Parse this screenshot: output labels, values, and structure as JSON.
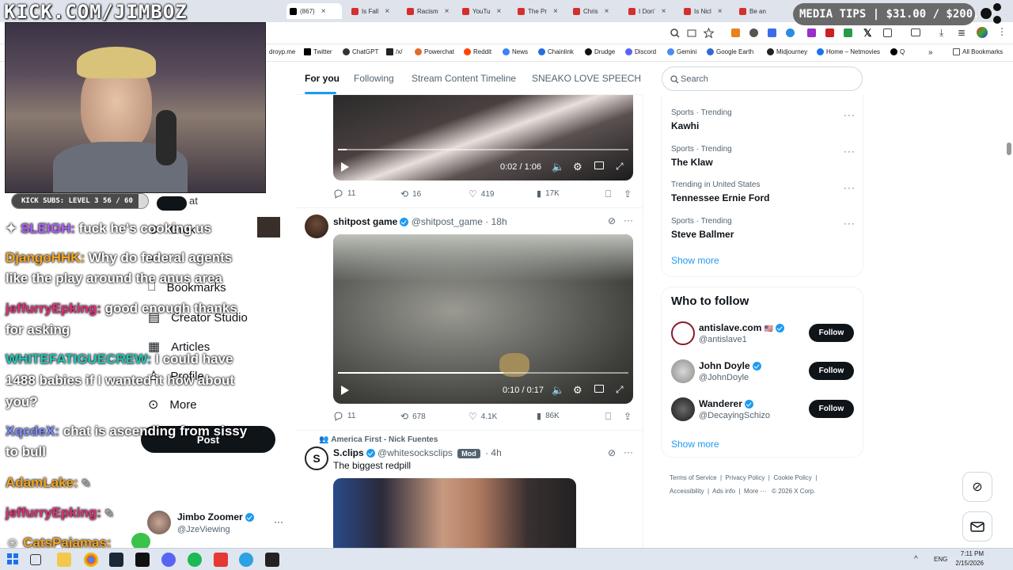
{
  "stream": {
    "url_banner": "KICK.COM/JIMBOZ",
    "media_tips": "MEDIA TIPS | $31.00 / $200.00",
    "subs_goal": "KICK SUBS: LEVEL 3 56 / 60",
    "chat": [
      {
        "user": "SLEIGH:",
        "color": "#b05cff",
        "msg": "fuck he's cooking us"
      },
      {
        "user": "DjangoHHK:",
        "color": "#f5a623",
        "msg": "Why do federal agents"
      },
      {
        "user": "",
        "color": "#ffffff",
        "msg": "like the play around the anus area"
      },
      {
        "user": "jeffurryEpking:",
        "color": "#e0307a",
        "msg": "good enough thanks"
      },
      {
        "user": "",
        "color": "#ffffff",
        "msg": "for asking"
      },
      {
        "user": "WHITEFATIGUECREW:",
        "color": "#21c6b8",
        "msg": "I could have"
      },
      {
        "user": "",
        "color": "#ffffff",
        "msg": "1488 babies if I wanted it how about"
      },
      {
        "user": "",
        "color": "#ffffff",
        "msg": "you?"
      },
      {
        "user": "XqcdeX:",
        "color": "#7a8cff",
        "msg": "chat is ascending from sissy"
      },
      {
        "user": "",
        "color": "#ffffff",
        "msg": "to bull"
      },
      {
        "user": "AdamLake:",
        "color": "#f5a623",
        "msg": ""
      },
      {
        "user": "jeffurryEpking:",
        "color": "#e0307a",
        "msg": ""
      },
      {
        "user": "CatsPajamas:",
        "color": "#f5a623",
        "msg": ""
      }
    ]
  },
  "browser": {
    "tabs": [
      {
        "label": "(867)"
      },
      {
        "label": "Is Fall"
      },
      {
        "label": "Racism"
      },
      {
        "label": "YouTu"
      },
      {
        "label": "The Pr"
      },
      {
        "label": "Chris"
      },
      {
        "label": "I Don'"
      },
      {
        "label": "Is Nicl"
      },
      {
        "label": "Be an"
      }
    ],
    "bookmarks": [
      "droyp.me",
      "Twitter",
      "ChatGPT",
      "/x/",
      "Powerchat",
      "Reddit",
      "News",
      "Chainlink",
      "Drudge",
      "Discord",
      "Gemini",
      "Google Earth",
      "Midjourney",
      "Home – Netmovies",
      "Q",
      "All Bookmarks"
    ]
  },
  "nav_menu": {
    "items": [
      "Grok",
      "Bookmarks",
      "Creator Studio",
      "Articles",
      "Profile",
      "More"
    ],
    "post_label": "Post",
    "partial_label": "at",
    "account": {
      "name": "Jimbo Zoomer",
      "handle": "@JzeViewing"
    }
  },
  "feed": {
    "tabs": [
      "For you",
      "Following",
      "Stream Content Timeline",
      "SNEAKO LOVE SPEECH"
    ],
    "post1": {
      "time": "0:02 / 1:06",
      "replies": "11",
      "reposts": "16",
      "likes": "419",
      "views": "17K"
    },
    "post2": {
      "name": "shitpost game",
      "handle": "@shitpost_game",
      "ago": "· 18h",
      "time": "0:10 / 0:17",
      "replies": "11",
      "reposts": "678",
      "likes": "4.1K",
      "views": "86K"
    },
    "post3": {
      "community": "America First - Nick Fuentes",
      "name": "S.clips",
      "handle": "@whitesocksclips",
      "badge": "Mod",
      "ago": "· 4h",
      "text": "The biggest redpill"
    }
  },
  "sidebar": {
    "search_placeholder": "Search",
    "trends": [
      {
        "meta": "Sports · Trending",
        "name": "Kawhi"
      },
      {
        "meta": "Sports · Trending",
        "name": "The Klaw"
      },
      {
        "meta": "Trending in United States",
        "name": "Tennessee Ernie Ford"
      },
      {
        "meta": "Sports · Trending",
        "name": "Steve Ballmer"
      }
    ],
    "show_more": "Show more",
    "who_to_follow": "Who to follow",
    "follow": [
      {
        "name": "antislave.com",
        "handle": "@antislave1",
        "button": "Follow"
      },
      {
        "name": "John Doyle",
        "handle": "@JohnDoyle",
        "button": "Follow"
      },
      {
        "name": "Wanderer",
        "handle": "@DecayingSchizo",
        "button": "Follow"
      }
    ],
    "show_more_2": "Show more",
    "footer": [
      "Terms of Service",
      "Privacy Policy",
      "Cookie Policy",
      "Accessibility",
      "Ads info",
      "More ···",
      "© 2026 X Corp."
    ]
  },
  "taskbar": {
    "lang": "ENG",
    "time": "7:11 PM",
    "date": "2/15/2026"
  }
}
